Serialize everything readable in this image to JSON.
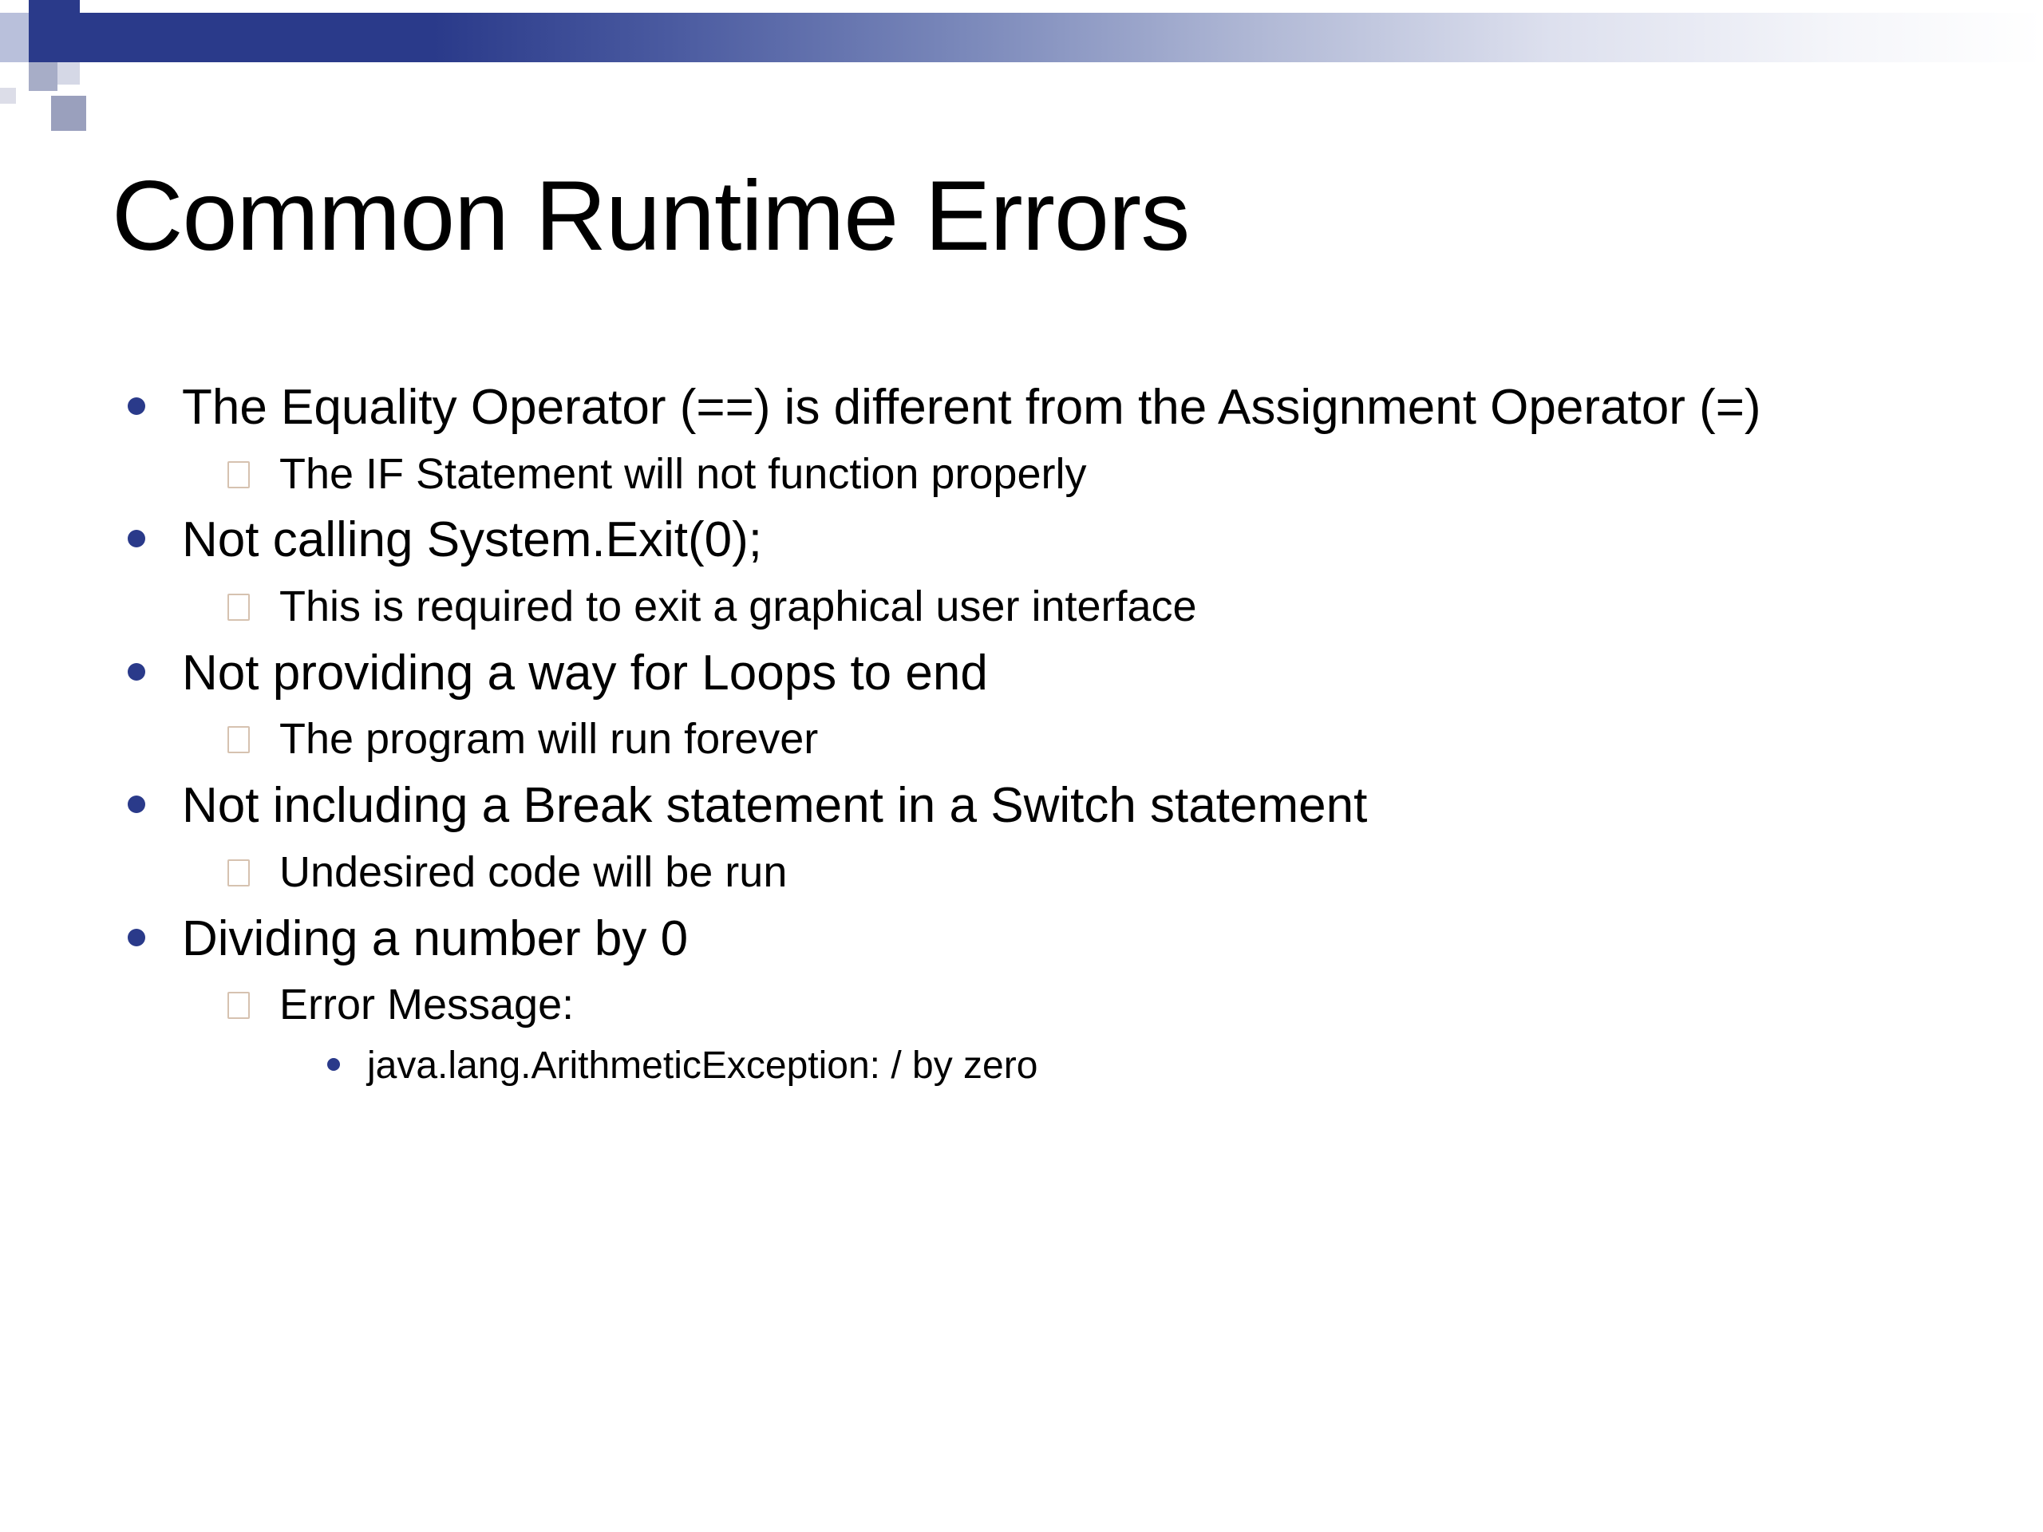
{
  "title": "Common Runtime Errors",
  "colors": {
    "accent": "#2a3a8a",
    "text": "#000000",
    "sub_bullet_outline": "#b49070"
  },
  "items": [
    {
      "text": "The Equality Operator (==) is different from the Assignment Operator (=)",
      "subs": [
        {
          "text": "The IF Statement will not function properly"
        }
      ]
    },
    {
      "text": "Not calling System.Exit(0);",
      "subs": [
        {
          "text": "This is required to exit a graphical user interface"
        }
      ]
    },
    {
      "text": "Not providing a way for Loops to end",
      "subs": [
        {
          "text": "The program will run forever"
        }
      ]
    },
    {
      "text": "Not including a Break statement in a Switch statement",
      "subs": [
        {
          "text": "Undesired code will be run"
        }
      ]
    },
    {
      "text": "Dividing a number by 0",
      "subs": [
        {
          "text": "Error Message:",
          "subs": [
            {
              "text": "java.lang.ArithmeticException: / by zero"
            }
          ]
        }
      ]
    }
  ]
}
